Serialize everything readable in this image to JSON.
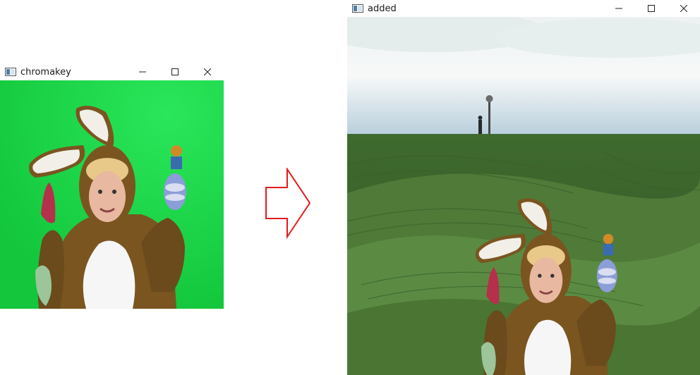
{
  "windows": {
    "left": {
      "title": "chromakey"
    },
    "right": {
      "title": "added"
    }
  },
  "icons": {
    "app": "opencv-window-icon",
    "minimize": "minimize-icon",
    "maximize": "maximize-icon",
    "close": "close-icon",
    "arrow": "right-arrow-icon"
  },
  "colors": {
    "green_screen": "#1ed94a",
    "arrow_stroke": "#e41a1c",
    "field_green": "#4f7a38",
    "sky": "#dfe9ee"
  }
}
